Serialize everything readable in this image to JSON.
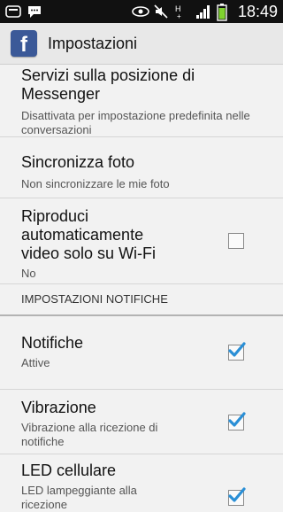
{
  "status_bar": {
    "time": "18:49",
    "icons": [
      "bbm-icon",
      "chat-icon",
      "eye-icon",
      "mute-icon",
      "hplus-icon",
      "signal-icon",
      "battery-icon"
    ]
  },
  "action_bar": {
    "logo": "f",
    "title": "Impostazioni"
  },
  "settings": {
    "location": {
      "title": "Servizi sulla posizione di Messenger",
      "summary": "Disattivata per impostazione predefinita nelle conversazioni"
    },
    "photo_sync": {
      "title": "Sincronizza foto",
      "summary": "Non sincronizzare le mie foto"
    },
    "autoplay": {
      "title": "Riproduci automaticamente video solo su Wi-Fi",
      "summary": "No",
      "checked": false
    },
    "notifications_header": "IMPOSTAZIONI NOTIFICHE",
    "notifications": {
      "title": "Notifiche",
      "summary": "Attive",
      "checked": true
    },
    "vibration": {
      "title": "Vibrazione",
      "summary": "Vibrazione alla ricezione di notifiche",
      "checked": true
    },
    "led": {
      "title": "LED cellulare",
      "summary": "LED lampeggiante alla ricezione",
      "checked": true
    }
  },
  "colors": {
    "accent_check": "#2a8fd6",
    "facebook_blue": "#3b5998"
  }
}
